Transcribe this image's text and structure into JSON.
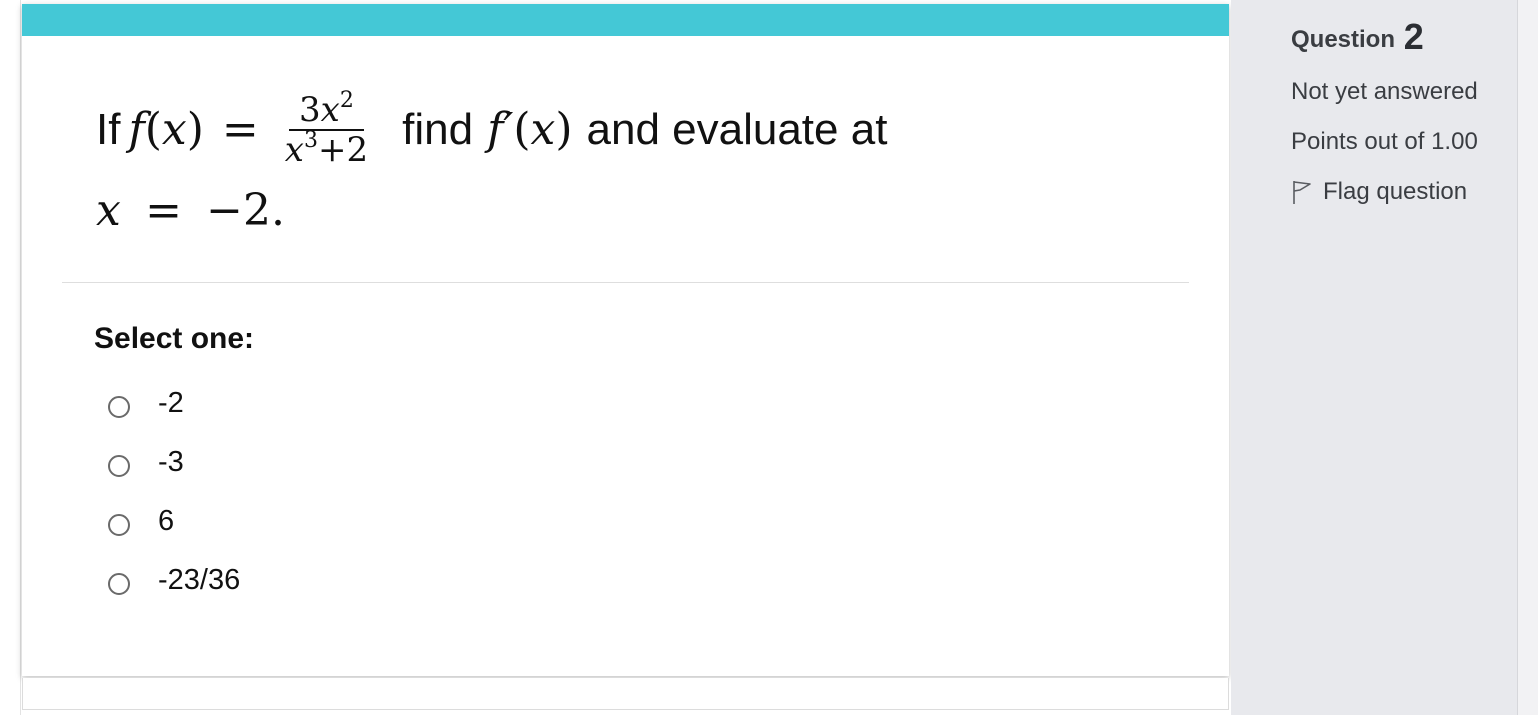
{
  "question": {
    "lead": "If",
    "func_name": "f",
    "var": "x",
    "equals": "=",
    "frac_num_coef": "3",
    "frac_num_var": "x",
    "frac_num_exp": "2",
    "frac_den_var": "x",
    "frac_den_exp": "3",
    "frac_den_rest": "+2",
    "mid_text": "find",
    "deriv_name": "f′",
    "end_text": "and evaluate at",
    "eval_var": "x",
    "eval_value": "−2."
  },
  "prompt": "Select one:",
  "options": [
    {
      "label": "-2"
    },
    {
      "label": "-3"
    },
    {
      "label": "6"
    },
    {
      "label": "-23/36"
    }
  ],
  "sidebar": {
    "question_word": "Question",
    "question_number": "2",
    "status": "Not yet answered",
    "points": "Points out of 1.00",
    "flag_label": "Flag question",
    "flag_icon": "flag-icon"
  },
  "colors": {
    "accent_bar": "#44c8d6",
    "sidebar_bg": "#e8e9ed"
  }
}
